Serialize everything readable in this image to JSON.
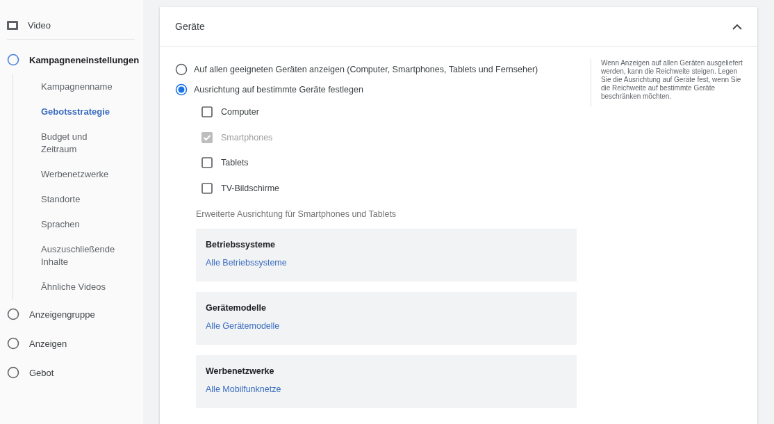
{
  "sidebar": {
    "steps": [
      {
        "kind": "video",
        "label": "Video",
        "selected": false
      },
      {
        "kind": "step",
        "label": "Kampagneneinstellungen",
        "selected": true,
        "children": [
          {
            "label": "Kampagnenname",
            "selected": false
          },
          {
            "label": "Gebotsstrategie",
            "selected": true
          },
          {
            "label": "Budget und Zeitraum",
            "selected": false
          },
          {
            "label": "Werbenetzwerke",
            "selected": false
          },
          {
            "label": "Standorte",
            "selected": false
          },
          {
            "label": "Sprachen",
            "selected": false
          },
          {
            "label": "Auszuschließende Inhalte",
            "selected": false
          },
          {
            "label": "Ähnliche Videos",
            "selected": false
          }
        ]
      },
      {
        "kind": "step",
        "label": "Anzeigengruppe",
        "selected": false
      },
      {
        "kind": "step",
        "label": "Anzeigen",
        "selected": false
      },
      {
        "kind": "step",
        "label": "Gebot",
        "selected": false
      }
    ]
  },
  "card": {
    "title": "Geräte",
    "expanded": true,
    "radios": [
      {
        "label": "Auf allen geeigneten Geräten anzeigen (Computer, Smartphones, Tablets und Fernseher)",
        "selected": false
      },
      {
        "label": "Ausrichtung auf bestimmte Geräte festlegen",
        "selected": true
      }
    ],
    "devices": [
      {
        "label": "Computer",
        "checked": false,
        "disabled": false
      },
      {
        "label": "Smartphones",
        "checked": true,
        "disabled": true
      },
      {
        "label": "Tablets",
        "checked": false,
        "disabled": false
      },
      {
        "label": "TV-Bildschirme",
        "checked": false,
        "disabled": false
      }
    ],
    "advanced_title": "Erweiterte Ausrichtung für Smartphones und Tablets",
    "panels": [
      {
        "title": "Betriebssysteme",
        "link": "Alle Betriebssysteme"
      },
      {
        "title": "Gerätemodelle",
        "link": "Alle Gerätemodelle"
      },
      {
        "title": "Werbenetzwerke",
        "link": "Alle Mobilfunknetze"
      }
    ],
    "help": "Wenn Anzeigen auf allen Geräten ausgeliefert werden, kann die Reichweite steigen. Legen Sie die Ausrichtung auf Geräte fest, wenn Sie die Reichweite auf bestimmte Geräte beschränken möchten."
  }
}
